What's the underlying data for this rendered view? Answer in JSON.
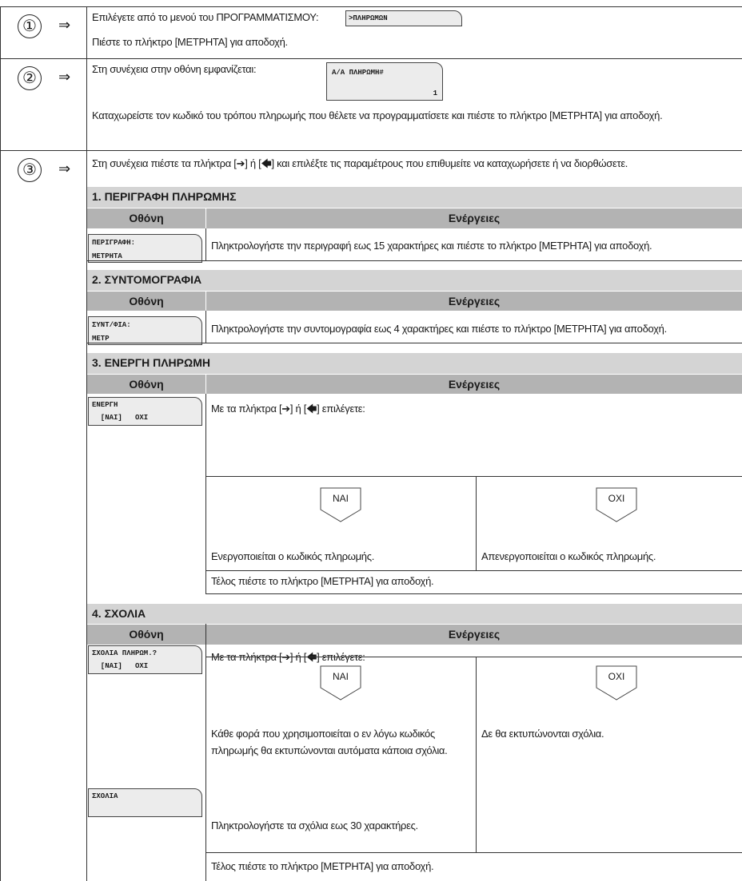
{
  "top_caption": "",
  "steps": [
    {
      "number": "①",
      "arrow": "⇒",
      "line1": "Επιλέγετε από το μενού του ΠΡΟΓΡΑΜΜΑΤΙΣΜΟΥ:",
      "display": ">ΠΛΗΡΩΜΩΝ",
      "line2": "Πιέστε το πλήκτρο [ΜΕΤΡΗΤΑ] για αποδοχή."
    },
    {
      "number": "②",
      "arrow": "⇒",
      "line1": "Στη συνέχεια στην οθόνη εμφανίζεται:",
      "display_line1": "Α/Α ΠΛΗΡΩΜΗ#",
      "display_line2": "1",
      "line2": "Καταχωρείστε τον κωδικό του τρόπου πληρωμής που θέλετε να προγραμματίσετε και πιέστε το πλήκτρο [ΜΕΤΡΗΤΑ] για αποδοχή."
    },
    {
      "number": "③",
      "arrow": "⇒",
      "line1": "Στη συνέχεια πιέστε τα πλήκτρα [➔] ή [🡄] και επιλέξτε τις παραμέτρους που επιθυμείτε να καταχωρήσετε ή να διορθώσετε."
    }
  ],
  "col_screen": "Οθόνη",
  "col_actions": "Ενέργειες",
  "sections": [
    {
      "title": "1. ΠΕΡΙΓΡΑΦΗ ΠΛΗΡΩΜΗΣ",
      "display_line1": "ΠΕΡΙΓΡΑΦΗ:",
      "display_line2": "ΜΕΤΡΗΤΑ",
      "action": "Πληκτρολογήστε την περιγραφή εως 15 χαρακτήρες και πιέστε το πλήκτρο [ΜΕΤΡΗΤΑ] για αποδοχή."
    },
    {
      "title": "2. ΣΥΝΤΟΜΟΓΡΑΦΙΑ",
      "display_line1": "ΣΥΝΤ/ΦΙΑ:",
      "display_line2": "ΜΕΤΡ",
      "action": "Πληκτρολογήστε την συντομογραφία εως 4 χαρακτήρες και πιέστε το πλήκτρο [ΜΕΤΡΗΤΑ] για αποδοχή."
    },
    {
      "title": "3. ΕΝΕΡΓΗ ΠΛΗΡΩΜΗ",
      "display_line1": "ΕΝΕΡΓΗ",
      "display_line2": "  [ΝΑΙ]   ΟΧΙ",
      "choose": "Με τα πλήκτρα [➔] ή [🡄] επιλέγετε:",
      "yes_key": "ΝΑΙ",
      "no_key": "ΟΧΙ",
      "yes_text": "Ενεργοποιείται ο κωδικός πληρωμής.",
      "no_text": "Απενεργοποιείται ο κωδικός πληρωμής.",
      "finish": "Τέλος πιέστε το πλήκτρο [ΜΕΤΡΗΤΑ] για αποδοχή."
    },
    {
      "title": "4. ΣΧΟΛΙΑ",
      "display_line1": "ΣΧΟΛΙΑ ΠΛΗΡΩΜ.?",
      "display_line2": "  [ΝΑΙ]   ΟΧΙ",
      "choose": "Με τα πλήκτρα [➔] ή [🡄] επιλέγετε:",
      "yes_key": "ΝΑΙ",
      "no_key": "ΟΧΙ",
      "yes_text_1": "Κάθε φορά που χρησιμοποιείται ο εν λόγω κωδικός",
      "yes_text_2": "πληρωμής θα εκτυπώνονται αυτόματα κάποια σχόλια.",
      "no_text": "Δε θα εκτυπώνονται σχόλια.",
      "comments_display": "ΣΧΟΛΙΑ",
      "comments_text": "Πληκτρολογήστε τα σχόλια εως 30 χαρακτήρες.",
      "finish": "Τέλος πιέστε το πλήκτρο [ΜΕΤΡΗΤΑ] για αποδοχή."
    }
  ]
}
